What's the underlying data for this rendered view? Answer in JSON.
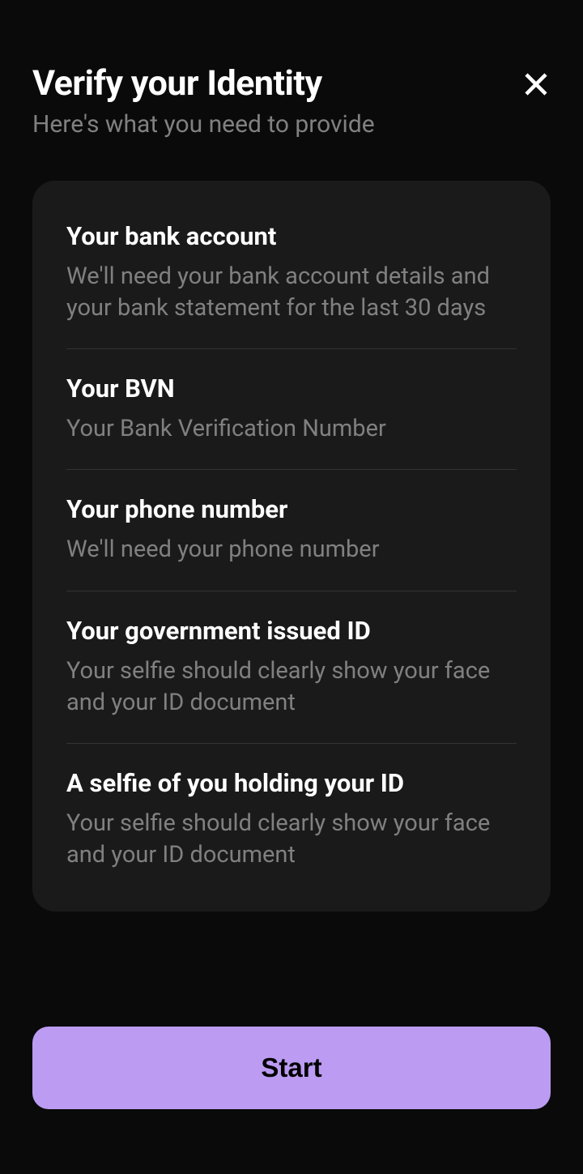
{
  "header": {
    "title": "Verify your Identity",
    "subtitle": "Here's what you need to provide"
  },
  "requirements": [
    {
      "title": "Your bank account",
      "description": "We'll need your bank account details and your bank statement for the last 30 days"
    },
    {
      "title": "Your BVN",
      "description": "Your Bank Verification Number"
    },
    {
      "title": "Your phone number",
      "description": "We'll need your phone number"
    },
    {
      "title": "Your government issued ID",
      "description": "Your selfie should clearly show your face and your ID document"
    },
    {
      "title": "A selfie of you holding your ID",
      "description": "Your selfie should clearly show your face and your ID document"
    }
  ],
  "button": {
    "start_label": "Start"
  }
}
